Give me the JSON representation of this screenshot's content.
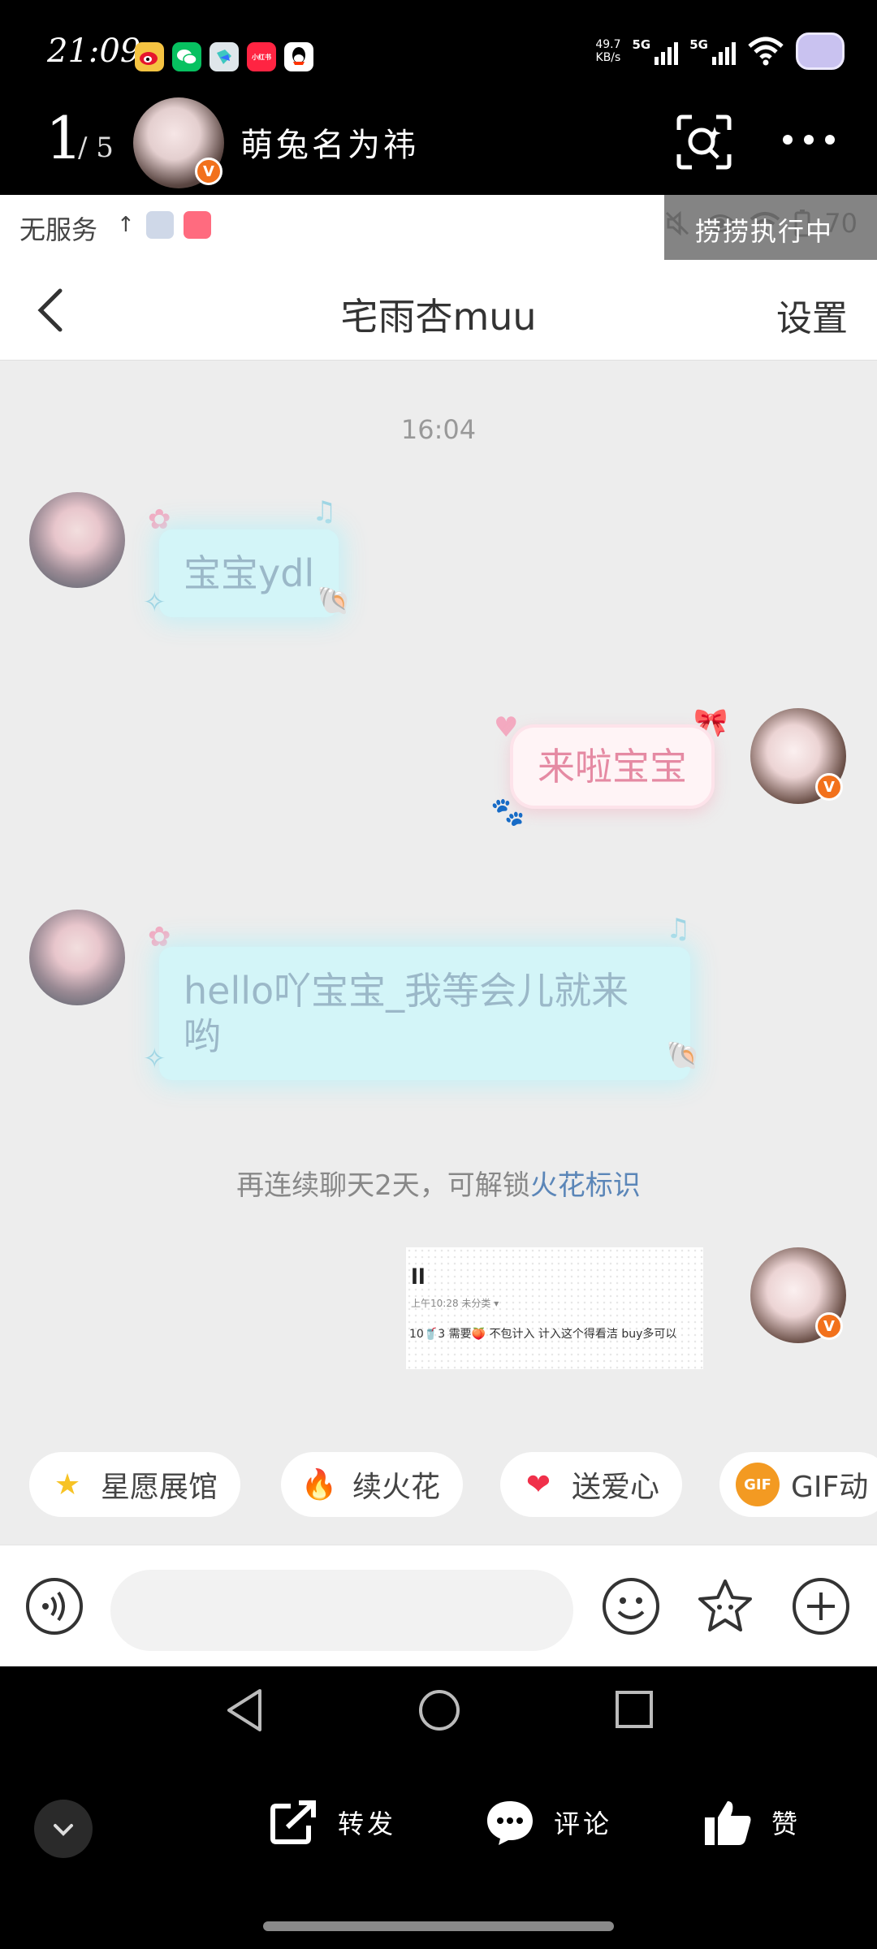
{
  "outer_status": {
    "time": "21:09",
    "net_speed_value": "49.7",
    "net_speed_unit": "KB/s",
    "signal1_label": "5G",
    "signal2_label": "5G",
    "app_icons": [
      "weibo-icon",
      "wechat-icon",
      "feishu-icon",
      "xiaohongshu-icon",
      "qq-icon"
    ],
    "app_icon_text": "小红书"
  },
  "outer_header": {
    "page_index": "1",
    "page_total": "/ 5",
    "author_name": "萌兔名为祎",
    "verified_badge": "V"
  },
  "inner_status": {
    "carrier": "无服务",
    "up_arrow": "↑",
    "battery_text": "70",
    "overlay_text": "捞捞执行中"
  },
  "chat": {
    "back_label": "‹",
    "title": "宅雨杏muu",
    "settings_label": "设置",
    "timestamp": "16:04",
    "messages": [
      {
        "sender": "other",
        "text": "宝宝ydl"
      },
      {
        "sender": "me",
        "text": "来啦宝宝"
      },
      {
        "sender": "other",
        "text": "hello吖宝宝_我等会儿就来哟"
      }
    ],
    "tip_prefix": "再连续聊天2天，可解锁",
    "tip_link": "火花标识",
    "image_message": {
      "line1": "ll",
      "line2": "上午10:28   未分类 ▾",
      "line3": "10🥤3 需要🍑 不包计入 计入这个得看洁 buy多可以"
    }
  },
  "quick_actions": [
    {
      "icon": "star-icon",
      "glyph": "★",
      "label": "星愿展馆"
    },
    {
      "icon": "fire-icon",
      "glyph": "🔥",
      "label": "续火花"
    },
    {
      "icon": "heart-icon",
      "glyph": "❤",
      "label": "送爱心"
    },
    {
      "icon": "gif-icon",
      "glyph": "GIF",
      "label": "GIF动"
    }
  ],
  "input": {
    "placeholder": ""
  },
  "bottom_actions": {
    "share": "转发",
    "comment": "评论",
    "like": "赞"
  },
  "colors": {
    "cyan_bubble": "#d3f5f8",
    "pink_bubble": "#fff4f6",
    "link": "#5b86b8",
    "badge": "#f2711c"
  }
}
